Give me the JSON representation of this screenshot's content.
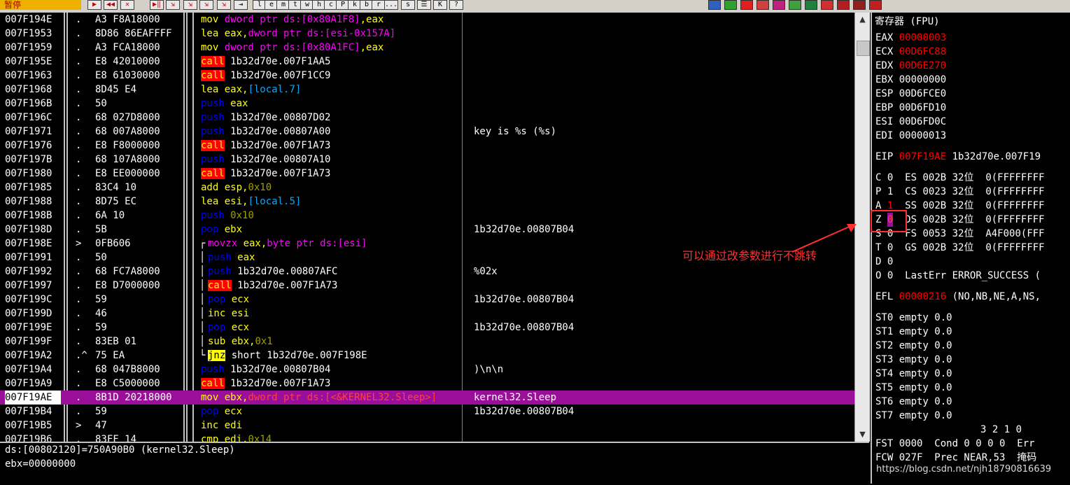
{
  "toolbar": {
    "status": "暂停",
    "buttons": [
      "▶",
      "◀◀",
      "✕",
      "▶‖",
      "⇲",
      "⇲",
      "⇲",
      "⇲",
      "⇥",
      "l",
      "e",
      "m",
      "t",
      "w",
      "h",
      "c",
      "P",
      "k",
      "b",
      "r",
      "...",
      "s",
      "☰",
      "K",
      "?"
    ]
  },
  "colors": {
    "selected_row": "#9a0f9a",
    "call_bg": "#ff0000",
    "jnz_bg": "#ffff00",
    "annotation": "#ff3030"
  },
  "disasm": {
    "rows": [
      {
        "addr": "007F194E",
        "mark": ".",
        "hex": "A3 F8A18000",
        "asm": [
          [
            "k-mov",
            "mov "
          ],
          [
            "op-mem",
            "dword ptr ds:[0x80A1F8]"
          ],
          [
            "op-reg",
            ",eax"
          ]
        ],
        "cmt": ""
      },
      {
        "addr": "007F1953",
        "mark": ".",
        "hex": "8D86 86EAFFFF",
        "asm": [
          [
            "k-lea",
            "lea "
          ],
          [
            "op-reg",
            "eax,"
          ],
          [
            "op-mem",
            "dword ptr ds:[esi-0x157A]"
          ]
        ],
        "cmt": ""
      },
      {
        "addr": "007F1959",
        "mark": ".",
        "hex": "A3 FCA18000",
        "asm": [
          [
            "k-mov",
            "mov "
          ],
          [
            "op-mem",
            "dword ptr ds:[0x80A1FC]"
          ],
          [
            "op-reg",
            ",eax"
          ]
        ],
        "cmt": ""
      },
      {
        "addr": "007F195E",
        "mark": ".",
        "hex": "E8 42010000",
        "asm": [
          [
            "k-call",
            "call"
          ],
          [
            "op-text",
            " 1b32d70e.007F1AA5"
          ]
        ],
        "cmt": ""
      },
      {
        "addr": "007F1963",
        "mark": ".",
        "hex": "E8 61030000",
        "asm": [
          [
            "k-call",
            "call"
          ],
          [
            "op-text",
            " 1b32d70e.007F1CC9"
          ]
        ],
        "cmt": ""
      },
      {
        "addr": "007F1968",
        "mark": ".",
        "hex": "8D45 E4",
        "asm": [
          [
            "k-lea",
            "lea "
          ],
          [
            "op-reg",
            "eax,"
          ],
          [
            "op-blue",
            "[local.7]"
          ]
        ],
        "cmt": ""
      },
      {
        "addr": "007F196B",
        "mark": ".",
        "hex": "50",
        "asm": [
          [
            "k-push",
            "push "
          ],
          [
            "op-reg",
            "eax"
          ]
        ],
        "cmt": ""
      },
      {
        "addr": "007F196C",
        "mark": ".",
        "hex": "68 027D8000",
        "asm": [
          [
            "k-push",
            "push "
          ],
          [
            "op-text",
            "1b32d70e.00807D02"
          ]
        ],
        "cmt": ""
      },
      {
        "addr": "007F1971",
        "mark": ".",
        "hex": "68 007A8000",
        "asm": [
          [
            "k-push",
            "push "
          ],
          [
            "op-text",
            "1b32d70e.00807A00"
          ]
        ],
        "cmt": "key is %s (%s)"
      },
      {
        "addr": "007F1976",
        "mark": ".",
        "hex": "E8 F8000000",
        "asm": [
          [
            "k-call",
            "call"
          ],
          [
            "op-text",
            " 1b32d70e.007F1A73"
          ]
        ],
        "cmt": ""
      },
      {
        "addr": "007F197B",
        "mark": ".",
        "hex": "68 107A8000",
        "asm": [
          [
            "k-push",
            "push "
          ],
          [
            "op-text",
            "1b32d70e.00807A10"
          ]
        ],
        "cmt": ""
      },
      {
        "addr": "007F1980",
        "mark": ".",
        "hex": "E8 EE000000",
        "asm": [
          [
            "k-call",
            "call"
          ],
          [
            "op-text",
            " 1b32d70e.007F1A73"
          ]
        ],
        "cmt": ""
      },
      {
        "addr": "007F1985",
        "mark": ".",
        "hex": "83C4 10",
        "asm": [
          [
            "k-add",
            "add "
          ],
          [
            "op-reg",
            "esp,"
          ],
          [
            "op-imm",
            "0x10"
          ]
        ],
        "cmt": ""
      },
      {
        "addr": "007F1988",
        "mark": ".",
        "hex": "8D75 EC",
        "asm": [
          [
            "k-lea",
            "lea "
          ],
          [
            "op-reg",
            "esi,"
          ],
          [
            "op-blue",
            "[local.5]"
          ]
        ],
        "cmt": ""
      },
      {
        "addr": "007F198B",
        "mark": ".",
        "hex": "6A 10",
        "asm": [
          [
            "k-push",
            "push "
          ],
          [
            "op-imm",
            "0x10"
          ]
        ],
        "cmt": ""
      },
      {
        "addr": "007F198D",
        "mark": ".",
        "hex": "5B",
        "asm": [
          [
            "k-pop",
            "pop "
          ],
          [
            "op-reg",
            "ebx"
          ]
        ],
        "cmt": "1b32d70e.00807B04"
      },
      {
        "addr": "007F198E",
        "mark": ">",
        "hex": "0FB606",
        "asm": [
          [
            "k-movzx",
            "movzx "
          ],
          [
            "op-reg",
            "eax,"
          ],
          [
            "op-mem",
            "byte ptr ds:[esi]"
          ]
        ],
        "cmt": "",
        "br": "┌"
      },
      {
        "addr": "007F1991",
        "mark": ".",
        "hex": "50",
        "asm": [
          [
            "k-push",
            "push "
          ],
          [
            "op-reg",
            "eax"
          ]
        ],
        "cmt": "",
        "br": "│"
      },
      {
        "addr": "007F1992",
        "mark": ".",
        "hex": "68 FC7A8000",
        "asm": [
          [
            "k-push",
            "push "
          ],
          [
            "op-text",
            "1b32d70e.00807AFC"
          ]
        ],
        "cmt": "%02x",
        "br": "│"
      },
      {
        "addr": "007F1997",
        "mark": ".",
        "hex": "E8 D7000000",
        "asm": [
          [
            "k-call",
            "call"
          ],
          [
            "op-text",
            " 1b32d70e.007F1A73"
          ]
        ],
        "cmt": "",
        "br": "│"
      },
      {
        "addr": "007F199C",
        "mark": ".",
        "hex": "59",
        "asm": [
          [
            "k-pop",
            "pop "
          ],
          [
            "op-reg",
            "ecx"
          ]
        ],
        "cmt": "1b32d70e.00807B04",
        "br": "│"
      },
      {
        "addr": "007F199D",
        "mark": ".",
        "hex": "46",
        "asm": [
          [
            "k-inc",
            "inc "
          ],
          [
            "op-reg",
            "esi"
          ]
        ],
        "cmt": "",
        "br": "│"
      },
      {
        "addr": "007F199E",
        "mark": ".",
        "hex": "59",
        "asm": [
          [
            "k-pop",
            "pop "
          ],
          [
            "op-reg",
            "ecx"
          ]
        ],
        "cmt": "1b32d70e.00807B04",
        "br": "│"
      },
      {
        "addr": "007F199F",
        "mark": ".",
        "hex": "83EB 01",
        "asm": [
          [
            "k-sub",
            "sub "
          ],
          [
            "op-reg",
            "ebx,"
          ],
          [
            "op-imm",
            "0x1"
          ]
        ],
        "cmt": "",
        "br": "│"
      },
      {
        "addr": "007F19A2",
        "mark": ".^",
        "hex": "75 EA",
        "asm": [
          [
            "k-jnz",
            "jnz"
          ],
          [
            "op-text",
            " short 1b32d70e.007F198E"
          ]
        ],
        "cmt": "",
        "br": "└"
      },
      {
        "addr": "007F19A4",
        "mark": ".",
        "hex": "68 047B8000",
        "asm": [
          [
            "k-push",
            "push "
          ],
          [
            "op-text",
            "1b32d70e.00807B04"
          ]
        ],
        "cmt": ")\\n\\n"
      },
      {
        "addr": "007F19A9",
        "mark": ".",
        "hex": "E8 C5000000",
        "asm": [
          [
            "k-call",
            "call"
          ],
          [
            "op-text",
            " 1b32d70e.007F1A73"
          ]
        ],
        "cmt": ""
      },
      {
        "addr": "007F19AE",
        "mark": ".",
        "hex": "8B1D 20218000",
        "asm": [
          [
            "k-mov",
            "mov "
          ],
          [
            "op-reg",
            "ebx,"
          ],
          [
            "op-red",
            "dword ptr ds:[<&KERNEL32.Sleep>]"
          ]
        ],
        "cmt": "kernel32.Sleep",
        "sel": true
      },
      {
        "addr": "007F19B4",
        "mark": ".",
        "hex": "59",
        "asm": [
          [
            "k-pop",
            "pop "
          ],
          [
            "op-reg",
            "ecx"
          ]
        ],
        "cmt": "1b32d70e.00807B04"
      },
      {
        "addr": "007F19B5",
        "mark": ">",
        "hex": "47",
        "asm": [
          [
            "k-inc",
            "inc "
          ],
          [
            "op-reg",
            "edi"
          ]
        ],
        "cmt": ""
      },
      {
        "addr": "007F19B6",
        "mark": ".",
        "hex": "83FF 14",
        "asm": [
          [
            "k-cmp",
            "cmp "
          ],
          [
            "op-reg",
            "edi,"
          ],
          [
            "op-imm",
            "0x14"
          ]
        ],
        "cmt": ""
      }
    ]
  },
  "info": {
    "line1": "ds:[00802120]=750A90B0 (kernel32.Sleep)",
    "line2": "ebx=00000000"
  },
  "registers": {
    "title": "寄存器 (FPU)",
    "gp": [
      {
        "name": "EAX",
        "value": "00000003",
        "changed": true
      },
      {
        "name": "ECX",
        "value": "00D6FC88",
        "changed": true
      },
      {
        "name": "EDX",
        "value": "00D6E270",
        "changed": true
      },
      {
        "name": "EBX",
        "value": "00000000",
        "changed": false
      },
      {
        "name": "ESP",
        "value": "00D6FCE0",
        "changed": false
      },
      {
        "name": "EBP",
        "value": "00D6FD10",
        "changed": false
      },
      {
        "name": "ESI",
        "value": "00D6FD0C",
        "changed": false
      },
      {
        "name": "EDI",
        "value": "00000013",
        "changed": false
      }
    ],
    "eip": {
      "name": "EIP",
      "value": "007F19AE",
      "desc": "1b32d70e.007F19"
    },
    "flags": [
      {
        "f": "C",
        "v": "0",
        "seg": "ES 002B 32位  0(FFFFFFFF"
      },
      {
        "f": "P",
        "v": "1",
        "seg": "CS 0023 32位  0(FFFFFFFF"
      },
      {
        "f": "A",
        "v": "1",
        "seg": "SS 002B 32位  0(FFFFFFFF"
      },
      {
        "f": "Z",
        "v": "0",
        "seg": "DS 002B 32位  0(FFFFFFFF"
      },
      {
        "f": "S",
        "v": "0",
        "seg": "FS 0053 32位  A4F000(FFF"
      },
      {
        "f": "T",
        "v": "0",
        "seg": "GS 002B 32位  0(FFFFFFFF"
      },
      {
        "f": "D",
        "v": "0",
        "seg": ""
      },
      {
        "f": "O",
        "v": "0",
        "seg": "LastErr ERROR_SUCCESS ("
      }
    ],
    "efl": {
      "name": "EFL",
      "value": "00000216",
      "desc": "(NO,NB,NE,A,NS,"
    },
    "st": [
      "ST0 empty 0.0",
      "ST1 empty 0.0",
      "ST2 empty 0.0",
      "ST3 empty 0.0",
      "ST4 empty 0.0",
      "ST5 empty 0.0",
      "ST6 empty 0.0",
      "ST7 empty 0.0"
    ],
    "fpu_hdr": "3 2 1 0",
    "fst": "FST 0000  Cond 0 0 0 0  Err",
    "fcw": "FCW 027F  Prec NEAR,53  掩码"
  },
  "annotation": {
    "text": "可以通过改参数进行不跳转"
  },
  "watermark": "https://blog.csdn.net/njh18790816639"
}
